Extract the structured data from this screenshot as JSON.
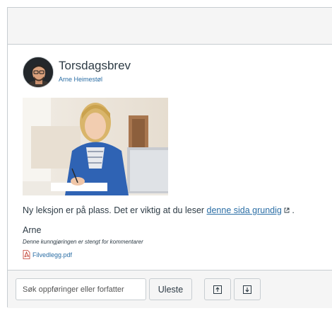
{
  "announcement": {
    "title": "Torsdagsbrev",
    "author": "Arne Heimestøl",
    "body_prefix": "Ny leksjon er på plass. Det er viktig at du leser ",
    "link_text": "denne sida grundig",
    "body_suffix": " .",
    "signature": "Arne",
    "comments_closed": "Denne kunngjøringen er stengt for kommentarer",
    "attachment": "Filvedlegg.pdf"
  },
  "toolbar": {
    "search_placeholder": "Søk oppføringer eller forfatter",
    "unread_label": "Uleste"
  },
  "colors": {
    "link": "#2b6ea5",
    "text": "#2d3b45",
    "bar_background": "#f5f5f5",
    "border": "#c7cdd1"
  },
  "icons": [
    "avatar",
    "external-link-icon",
    "pdf-icon",
    "expand-icon",
    "collapse-icon"
  ]
}
